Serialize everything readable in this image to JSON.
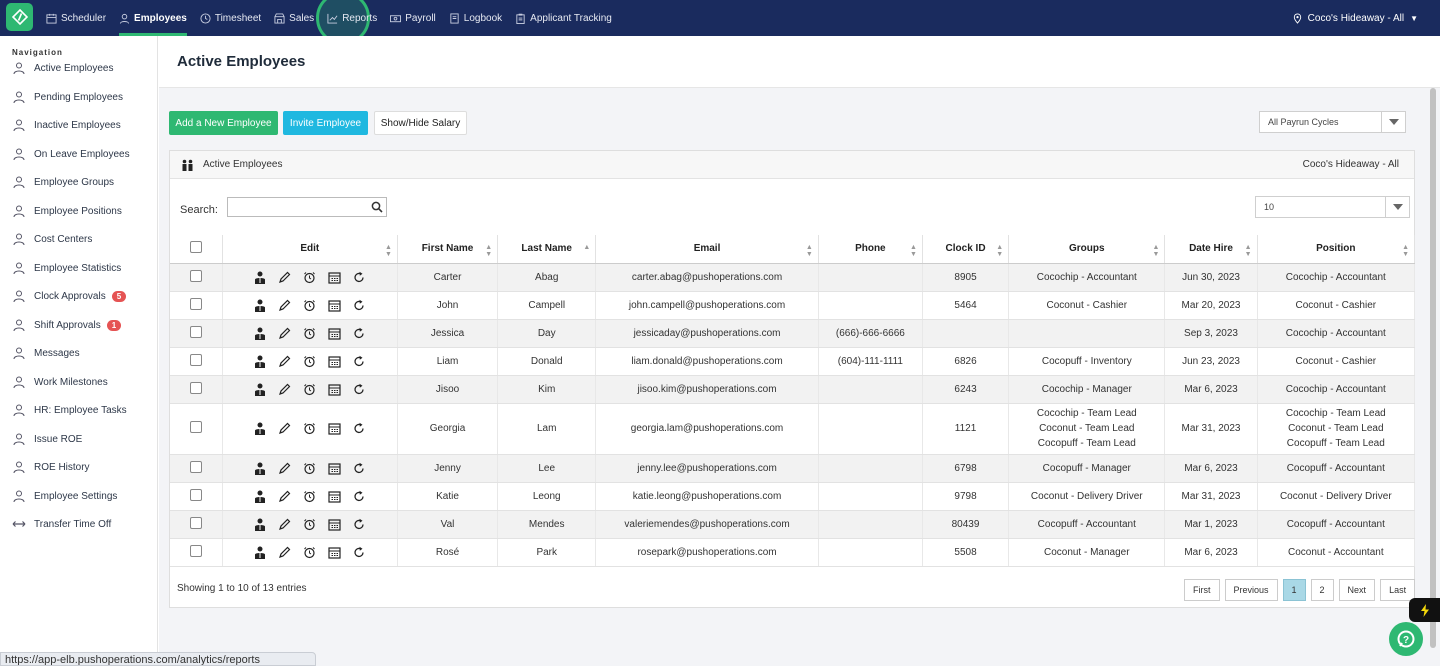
{
  "nav": {
    "items": [
      {
        "label": "Scheduler",
        "icon": "calendar-icon"
      },
      {
        "label": "Employees",
        "icon": "user-icon",
        "active": true
      },
      {
        "label": "Timesheet",
        "icon": "clock-icon"
      },
      {
        "label": "Sales",
        "icon": "store-icon"
      },
      {
        "label": "Reports",
        "icon": "chart-icon"
      },
      {
        "label": "Payroll",
        "icon": "money-icon"
      },
      {
        "label": "Logbook",
        "icon": "book-icon"
      },
      {
        "label": "Applicant Tracking",
        "icon": "clipboard-icon"
      }
    ],
    "location": "Coco's Hideaway - All"
  },
  "sidebar": {
    "heading": "Navigation",
    "items": [
      {
        "label": "Active Employees"
      },
      {
        "label": "Pending Employees"
      },
      {
        "label": "Inactive Employees"
      },
      {
        "label": "On Leave Employees"
      },
      {
        "label": "Employee Groups"
      },
      {
        "label": "Employee Positions"
      },
      {
        "label": "Cost Centers"
      },
      {
        "label": "Employee Statistics"
      },
      {
        "label": "Clock Approvals",
        "badge": "5"
      },
      {
        "label": "Shift Approvals",
        "badge": "1"
      },
      {
        "label": "Messages"
      },
      {
        "label": "Work Milestones"
      },
      {
        "label": "HR: Employee Tasks"
      },
      {
        "label": "Issue ROE"
      },
      {
        "label": "ROE History"
      },
      {
        "label": "Employee Settings"
      },
      {
        "label": "Transfer Time Off"
      }
    ]
  },
  "page": {
    "title": "Active Employees",
    "add_button": "Add a New Employee",
    "invite_button": "Invite Employee",
    "salary_button": "Show/Hide Salary",
    "payrun_select": "All Payrun Cycles",
    "panel_title": "Active Employees",
    "panel_location": "Coco's Hideaway - All",
    "search_label": "Search:",
    "page_size": "10",
    "showing": "Showing 1 to 10 of 13 entries"
  },
  "table": {
    "headers": [
      "Edit",
      "First Name",
      "Last Name",
      "Email",
      "Phone",
      "Clock ID",
      "Groups",
      "Date Hire",
      "Position"
    ],
    "rows": [
      {
        "first": "Carter",
        "last": "Abag",
        "email": "carter.abag@pushoperations.com",
        "phone": "",
        "clock": "8905",
        "groups": [
          "Cocochip - Accountant"
        ],
        "hire": "Jun 30, 2023",
        "position": [
          "Cocochip - Accountant"
        ]
      },
      {
        "first": "John",
        "last": "Campell",
        "email": "john.campell@pushoperations.com",
        "phone": "",
        "clock": "5464",
        "groups": [
          "Coconut - Cashier"
        ],
        "hire": "Mar 20, 2023",
        "position": [
          "Coconut - Cashier"
        ]
      },
      {
        "first": "Jessica",
        "last": "Day",
        "email": "jessicaday@pushoperations.com",
        "phone": "(666)-666-6666",
        "clock": "",
        "groups": [],
        "hire": "Sep 3, 2023",
        "position": [
          "Cocochip - Accountant"
        ]
      },
      {
        "first": "Liam",
        "last": "Donald",
        "email": "liam.donald@pushoperations.com",
        "phone": "(604)-111-1111",
        "clock": "6826",
        "groups": [
          "Cocopuff - Inventory"
        ],
        "hire": "Jun 23, 2023",
        "position": [
          "Coconut - Cashier"
        ]
      },
      {
        "first": "Jisoo",
        "last": "Kim",
        "email": "jisoo.kim@pushoperations.com",
        "phone": "",
        "clock": "6243",
        "groups": [
          "Cocochip - Manager"
        ],
        "hire": "Mar 6, 2023",
        "position": [
          "Cocochip - Accountant"
        ]
      },
      {
        "first": "Georgia",
        "last": "Lam",
        "email": "georgia.lam@pushoperations.com",
        "phone": "",
        "clock": "1121",
        "groups": [
          "Cocochip - Team Lead",
          "Coconut - Team Lead",
          "Cocopuff - Team Lead"
        ],
        "hire": "Mar 31, 2023",
        "position": [
          "Cocochip - Team Lead",
          "Coconut - Team Lead",
          "Cocopuff - Team Lead"
        ]
      },
      {
        "first": "Jenny",
        "last": "Lee",
        "email": "jenny.lee@pushoperations.com",
        "phone": "",
        "clock": "6798",
        "groups": [
          "Cocopuff - Manager"
        ],
        "hire": "Mar 6, 2023",
        "position": [
          "Cocopuff - Accountant"
        ]
      },
      {
        "first": "Katie",
        "last": "Leong",
        "email": "katie.leong@pushoperations.com",
        "phone": "",
        "clock": "9798",
        "groups": [
          "Coconut - Delivery Driver"
        ],
        "hire": "Mar 31, 2023",
        "position": [
          "Coconut - Delivery Driver"
        ]
      },
      {
        "first": "Val",
        "last": "Mendes",
        "email": "valeriemendes@pushoperations.com",
        "phone": "",
        "clock": "80439",
        "groups": [
          "Cocopuff - Accountant"
        ],
        "hire": "Mar 1, 2023",
        "position": [
          "Cocopuff - Accountant"
        ]
      },
      {
        "first": "Rosé",
        "last": "Park",
        "email": "rosepark@pushoperations.com",
        "phone": "",
        "clock": "5508",
        "groups": [
          "Coconut - Manager"
        ],
        "hire": "Mar 6, 2023",
        "position": [
          "Coconut - Accountant"
        ]
      }
    ]
  },
  "pager": {
    "first": "First",
    "previous": "Previous",
    "pages": [
      "1",
      "2"
    ],
    "next": "Next",
    "last": "Last"
  },
  "status_url": "https://app-elb.pushoperations.com/analytics/reports",
  "colors": {
    "nav_bg": "#1a2b5e",
    "accent_green": "#2eb872",
    "accent_blue": "#1fb8e0",
    "badge_red": "#e55353"
  }
}
